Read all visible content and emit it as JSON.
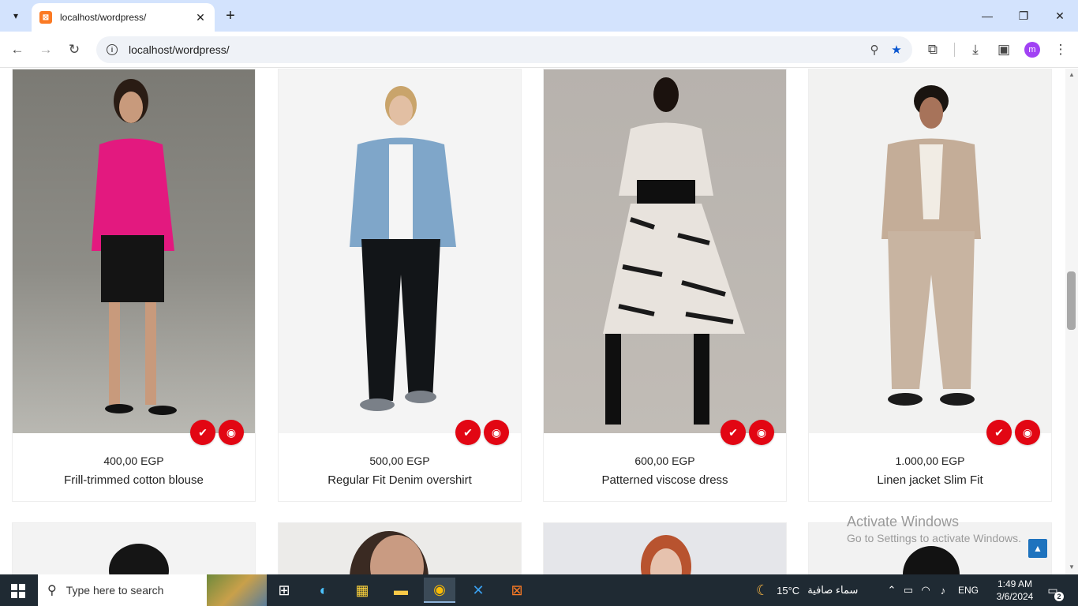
{
  "browser": {
    "tab_title": "localhost/wordpress/",
    "tab_favicon_glyph": "⊠",
    "url": "localhost/wordpress/",
    "profile_initial": "m",
    "new_tab_glyph": "+"
  },
  "products": [
    {
      "price": "400,00 EGP",
      "name": "Frill-trimmed cotton blouse"
    },
    {
      "price": "500,00 EGP",
      "name": "Regular Fit Denim overshirt"
    },
    {
      "price": "600,00 EGP",
      "name": "Patterned viscose dress"
    },
    {
      "price": "1.000,00 EGP",
      "name": "Linen jacket Slim Fit"
    }
  ],
  "overlay": {
    "activate_title": "Activate Windows",
    "activate_sub": "Go to Settings to activate Windows."
  },
  "taskbar": {
    "search_placeholder": "Type here to search",
    "weather_temp": "15°C",
    "weather_text": "سماء صافية",
    "language": "ENG",
    "time": "1:49 AM",
    "date": "3/6/2024",
    "notification_count": "2"
  },
  "colors": {
    "accent_red": "#e20613",
    "chrome_blue": "#d3e3fd",
    "taskbar": "#1f2a33",
    "back_to_top": "#1e73be"
  }
}
